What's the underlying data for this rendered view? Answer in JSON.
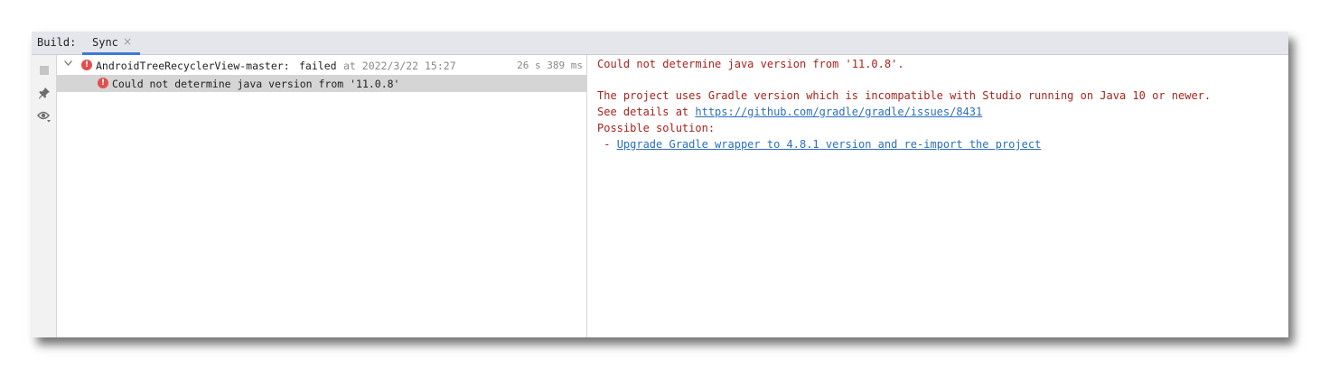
{
  "tabbar": {
    "label": "Build:",
    "tab_label": "Sync",
    "close_glyph": "×"
  },
  "sidebar": {
    "icons": [
      "stop-icon",
      "pin-icon",
      "eye-filter-icon"
    ]
  },
  "tree": {
    "root": {
      "project": "AndroidTreeRecyclerView-master:",
      "status": "failed",
      "at_text": "at 2022/3/22 15:27",
      "duration": "26 s 389 ms"
    },
    "child": {
      "message": "Could not determine java version from '11.0.8'"
    }
  },
  "console": {
    "line1": "Could not determine java version from '11.0.8'.",
    "line2": "The project uses Gradle version which is incompatible with Studio running on Java 10 or newer.",
    "line3_prefix": "See details at ",
    "line3_link": "https://github.com/gradle/gradle/issues/8431",
    "line4": "Possible solution:",
    "line5_prefix": " - ",
    "line5_link": "Upgrade Gradle wrapper to 4.8.1 version and re-import the project"
  },
  "colors": {
    "error": "#e0504f",
    "console_text": "#a8231c",
    "link": "#2a6fbf",
    "tab_accent": "#3d7ad6"
  }
}
